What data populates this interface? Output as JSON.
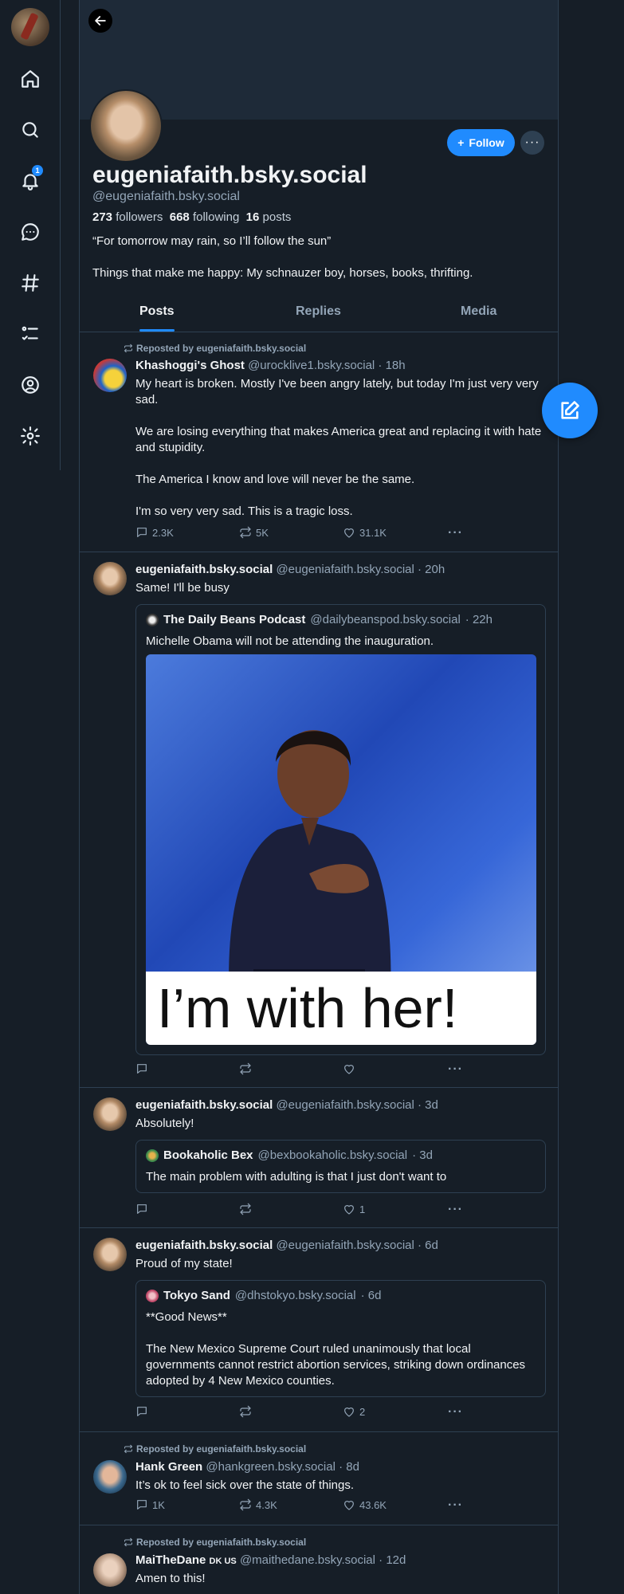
{
  "nav": {
    "notifications_badge": "1"
  },
  "profile": {
    "display_name": "eugeniafaith.bsky.social",
    "handle": "@eugeniafaith.bsky.social",
    "follow_label": "Follow",
    "followers_count": "273",
    "followers_label": "followers",
    "following_count": "668",
    "following_label": "following",
    "posts_count": "16",
    "posts_label": "posts",
    "bio_line1": "“For tomorrow may rain, so I’ll follow the sun”",
    "bio_line2": "Things that make me happy: My schnauzer boy, horses, books, thrifting."
  },
  "tabs": [
    "Posts",
    "Replies",
    "Media"
  ],
  "feed": [
    {
      "repost_label": "Reposted by eugeniafaith.bsky.social",
      "author": "Khashoggi's Ghost",
      "handle": "@urocklive1.bsky.social",
      "time": "· 18h",
      "paragraphs": [
        "My heart is broken. Mostly I've been angry lately, but today I'm just very very sad.",
        "We are losing everything that makes America great and replacing it with hate and stupidity.",
        "The America I know and love will never be the same.",
        "I'm so very very sad. This is a tragic loss."
      ],
      "replies": "2.3K",
      "reposts": "5K",
      "likes": "31.1K"
    },
    {
      "author": "eugeniafaith.bsky.social",
      "handle": "@eugeniafaith.bsky.social",
      "time": "· 20h",
      "text": "Same! I'll be busy",
      "quote": {
        "author": "The Daily Beans Podcast",
        "handle": "@dailybeanspod.bsky.social",
        "time": "· 22h",
        "text": "Michelle Obama will not be attending the inauguration.",
        "image_caption": "I’m with her!"
      }
    },
    {
      "author": "eugeniafaith.bsky.social",
      "handle": "@eugeniafaith.bsky.social",
      "time": "· 3d",
      "text": "Absolutely!",
      "quote": {
        "author": "Bookaholic Bex",
        "handle": "@bexbookaholic.bsky.social",
        "time": "· 3d",
        "text": "The main problem with adulting is that I just don't want to"
      },
      "likes": "1"
    },
    {
      "author": "eugeniafaith.bsky.social",
      "handle": "@eugeniafaith.bsky.social",
      "time": "· 6d",
      "text": "Proud of my state!",
      "quote": {
        "author": "Tokyo Sand",
        "handle": "@dhstokyo.bsky.social",
        "time": "· 6d",
        "paragraphs": [
          "**Good News**",
          "The New Mexico Supreme Court ruled unanimously that local governments cannot restrict abortion services, striking down ordinances adopted by 4 New Mexico counties."
        ]
      },
      "likes": "2"
    },
    {
      "repost_label": "Reposted by eugeniafaith.bsky.social",
      "author": "Hank Green",
      "handle": "@hankgreen.bsky.social",
      "time": "· 8d",
      "text": "It’s ok to feel sick over the state of things.",
      "replies": "1K",
      "reposts": "4.3K",
      "likes": "43.6K"
    },
    {
      "repost_label": "Reposted by eugeniafaith.bsky.social",
      "author": "MaiTheDane",
      "author_tag": "DK US",
      "handle": "@maithedane.bsky.social",
      "time": "· 12d",
      "text": "Amen to this!"
    }
  ],
  "colors": {
    "background": "#161e27",
    "accent": "#208bfe",
    "muted": "#93a5b7",
    "border": "#2e4052"
  }
}
